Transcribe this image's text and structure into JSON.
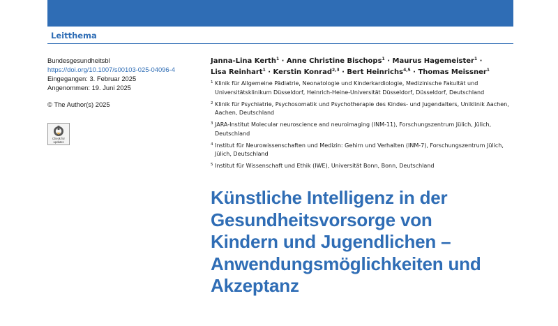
{
  "header": {
    "section_label": "Leitthema",
    "band_color": "#2f6db5"
  },
  "meta": {
    "journal": "Bundesgesundheitsbl",
    "doi": "https://doi.org/10.1007/s00103-025-04096-4",
    "received": "Eingegangen: 3. Februar 2025",
    "accepted": "Angenommen: 19. Juni 2025",
    "copyright": "© The Author(s) 2025",
    "badge_text": "Check for\nupdates"
  },
  "authors": [
    {
      "name": "Janna-Lina Kerth",
      "aff": "1"
    },
    {
      "name": "Anne Christine Bischops",
      "aff": "1"
    },
    {
      "name": "Maurus Hagemeister",
      "aff": "1"
    },
    {
      "name": "Lisa Reinhart",
      "aff": "1"
    },
    {
      "name": "Kerstin Konrad",
      "aff": "2,3"
    },
    {
      "name": "Bert Heinrichs",
      "aff": "4,5"
    },
    {
      "name": "Thomas Meissner",
      "aff": "1"
    }
  ],
  "affiliations": [
    {
      "num": "1",
      "text": "Klinik für Allgemeine Pädiatrie, Neonatologie und Kinderkardiologie, Medizinische Fakultät und Universitätsklinikum Düsseldorf, Heinrich-Heine-Universität Düsseldorf, Düsseldorf, Deutschland"
    },
    {
      "num": "2",
      "text": "Klinik für Psychiatrie, Psychosomatik und Psychotherapie des Kindes- und Jugendalters, Uniklinik Aachen, Aachen, Deutschland"
    },
    {
      "num": "3",
      "text": "JARA-Institut Molecular neuroscience and neuroimaging (INM-11), Forschungszentrum Jülich, Jülich, Deutschland"
    },
    {
      "num": "4",
      "text": "Institut für Neurowissenschaften und Medizin: Gehirn und Verhalten (INM-7), Forschungszentrum Jülich, Jülich, Deutschland"
    },
    {
      "num": "5",
      "text": "Institut für Wissenschaft und Ethik (IWE), Universität Bonn, Bonn, Deutschland"
    }
  ],
  "title": {
    "lines": [
      "Künstliche Intelligenz in der",
      "Gesundheitsvorsorge von",
      "Kindern und Jugendlichen –",
      "Anwendungsmöglichkeiten und",
      "Akzeptanz"
    ],
    "color": "#2f6db5"
  }
}
